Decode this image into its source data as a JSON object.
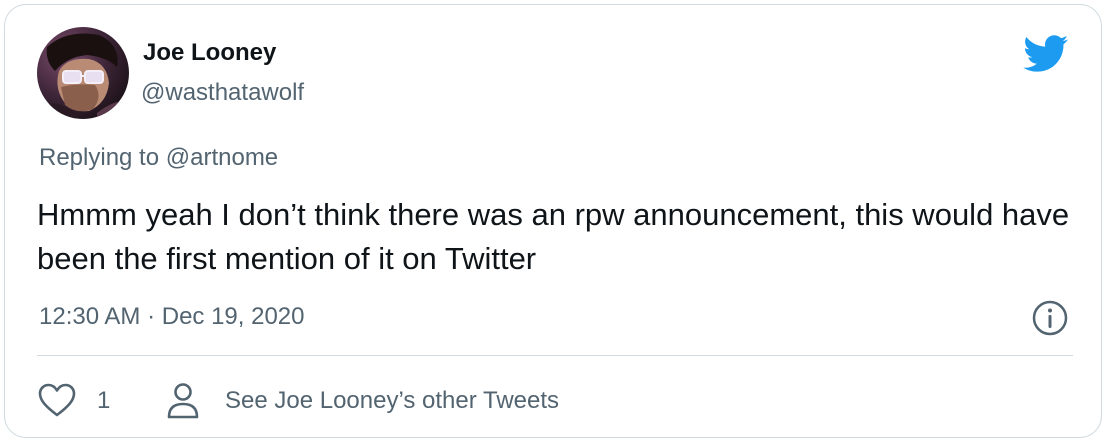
{
  "author": {
    "display_name": "Joe Looney",
    "handle": "@wasthatawolf",
    "avatar_icon": "user-avatar-photo"
  },
  "reply": {
    "prefix": "Replying to ",
    "mention": "@artnome"
  },
  "tweet": {
    "text": "Hmmm yeah I don’t think there was an rpw announcement, this would have been the first mention of it on Twitter",
    "timestamp": "12:30 AM · Dec 19, 2020"
  },
  "actions": {
    "like_count": "1",
    "other_tweets_label": "See Joe Looney’s other Tweets"
  },
  "icons": {
    "brand": "twitter-bird-icon",
    "info": "info-icon",
    "like": "heart-icon",
    "profile": "person-icon"
  },
  "colors": {
    "brand_blue": "#1d9bf0",
    "secondary_text": "#536471",
    "primary_text": "#0f1419",
    "border": "#cfd9de"
  }
}
